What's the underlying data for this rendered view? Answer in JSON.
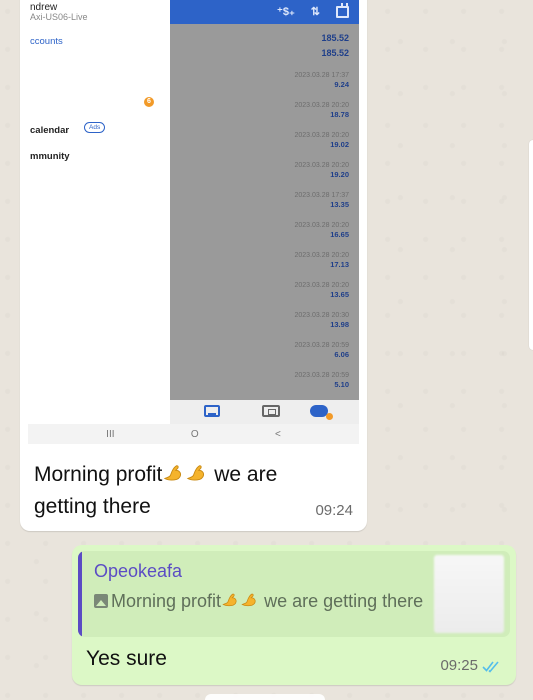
{
  "shot": {
    "user_name": "ndrew",
    "account": "Axi-US06-Live",
    "accounts_link": "ccounts",
    "badge": "6",
    "menu_calendar": "calendar",
    "ads_label": "Ads",
    "menu_community": "mmunity",
    "totals": [
      "185.52",
      "185.52"
    ],
    "trades": [
      {
        "date": "2023.03.28 17:37",
        "profit": "9.24"
      },
      {
        "date": "2023.03.28 20:20",
        "profit": "18.78"
      },
      {
        "date": "2023.03.28 20:20",
        "profit": "19.02"
      },
      {
        "date": "2023.03.28 20:20",
        "profit": "19.20"
      },
      {
        "date": "2023.03.28 17:37",
        "profit": "13.35"
      },
      {
        "date": "2023.03.28 20:20",
        "profit": "16.65"
      },
      {
        "date": "2023.03.28 20:20",
        "profit": "17.13"
      },
      {
        "date": "2023.03.28 20:20",
        "profit": "13.65"
      },
      {
        "date": "2023.03.28 20:30",
        "profit": "13.98"
      },
      {
        "date": "2023.03.28 20:59",
        "profit": "6.06"
      },
      {
        "date": "2023.03.28 20:59",
        "profit": "5.10"
      }
    ],
    "android_nav": [
      "III",
      "O",
      "<"
    ]
  },
  "incoming": {
    "text_before": "Morning profit",
    "text_after": " we are getting there",
    "time": "09:24"
  },
  "outgoing": {
    "quote_author": "Opeokeafa",
    "quote_before": "Morning profit",
    "quote_after": " we are getting there",
    "reply": "Yes sure",
    "time": "09:25"
  },
  "colors": {
    "app_blue": "#2d63c8",
    "outgoing_bubble": "#dcf8c6",
    "quote_accent": "#5b4cc4",
    "read_ticks": "#53bdeb"
  }
}
